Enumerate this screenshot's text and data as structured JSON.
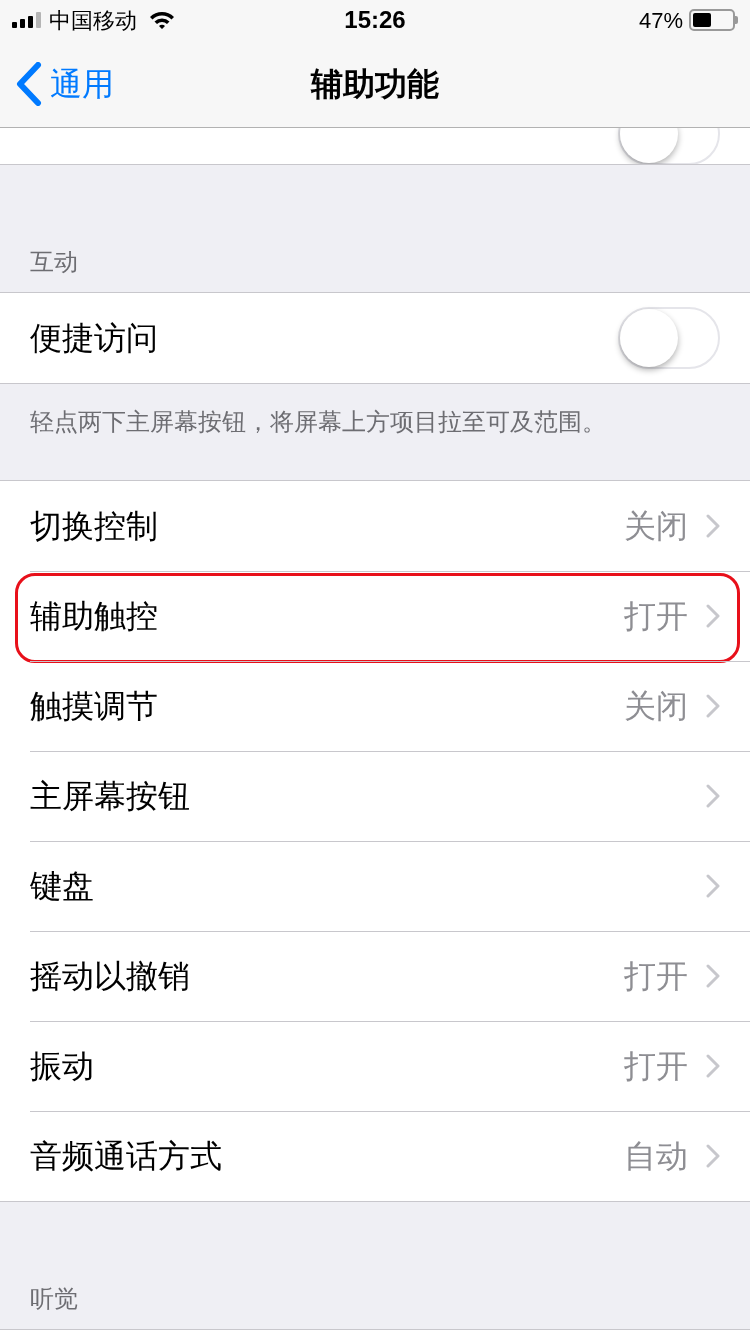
{
  "status_bar": {
    "carrier": "中国移动",
    "time": "15:26",
    "battery": "47%"
  },
  "nav": {
    "back": "通用",
    "title": "辅助功能"
  },
  "partial_row": {
    "on": false
  },
  "sections": [
    {
      "header": "互动",
      "rows": [
        {
          "kind": "toggle",
          "label": "便捷访问",
          "on": false,
          "highlighted": false
        }
      ],
      "footer": "轻点两下主屏幕按钮，将屏幕上方项目拉至可及范围。"
    },
    {
      "rows": [
        {
          "kind": "link",
          "label": "切换控制",
          "value": "关闭",
          "highlighted": false
        },
        {
          "kind": "link",
          "label": "辅助触控",
          "value": "打开",
          "highlighted": true
        },
        {
          "kind": "link",
          "label": "触摸调节",
          "value": "关闭",
          "highlighted": false
        },
        {
          "kind": "link",
          "label": "主屏幕按钮",
          "highlighted": false
        },
        {
          "kind": "link",
          "label": "键盘",
          "highlighted": false
        },
        {
          "kind": "link",
          "label": "摇动以撤销",
          "value": "打开",
          "highlighted": false
        },
        {
          "kind": "link",
          "label": "振动",
          "value": "打开",
          "highlighted": false
        },
        {
          "kind": "link",
          "label": "音频通话方式",
          "value": "自动",
          "highlighted": false
        }
      ]
    },
    {
      "header": "听觉"
    }
  ]
}
